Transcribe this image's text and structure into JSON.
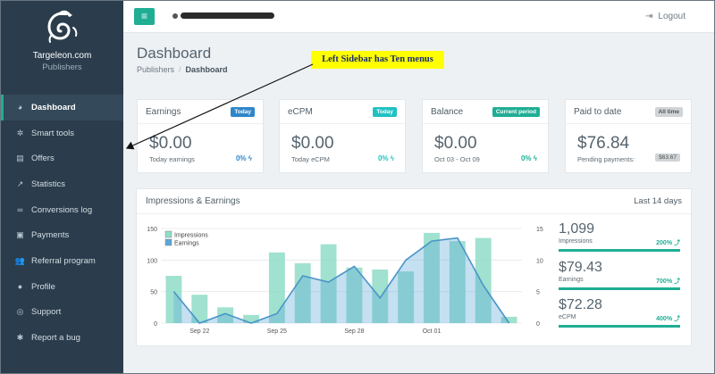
{
  "sidebar": {
    "brand_name": "Targeleon.com",
    "brand_sub": "Publishers",
    "items": [
      {
        "label": "Dashboard",
        "icon": "dashboard-icon",
        "active": true
      },
      {
        "label": "Smart tools",
        "icon": "gears-icon"
      },
      {
        "label": "Offers",
        "icon": "list-icon"
      },
      {
        "label": "Statistics",
        "icon": "chart-icon"
      },
      {
        "label": "Conversions log",
        "icon": "link-icon"
      },
      {
        "label": "Payments",
        "icon": "money-icon"
      },
      {
        "label": "Referral program",
        "icon": "users-icon"
      },
      {
        "label": "Profile",
        "icon": "user-icon"
      },
      {
        "label": "Support",
        "icon": "lifebuoy-icon"
      },
      {
        "label": "Report a bug",
        "icon": "bug-icon"
      }
    ]
  },
  "topbar": {
    "logout_label": "Logout"
  },
  "header": {
    "title": "Dashboard",
    "crumb_parent": "Publishers",
    "crumb_current": "Dashboard"
  },
  "annotation": {
    "text": "Left Sidebar has Ten menus"
  },
  "cards": [
    {
      "title": "Earnings",
      "badge": "Today",
      "value": "$0.00",
      "sub": "Today earnings",
      "pct": "0%"
    },
    {
      "title": "eCPM",
      "badge": "Today",
      "value": "$0.00",
      "sub": "Today eCPM",
      "pct": "0%"
    },
    {
      "title": "Balance",
      "badge": "Current period",
      "value": "$0.00",
      "sub": "Oct 03 - Oct 09",
      "pct": "0%"
    },
    {
      "title": "Paid to date",
      "badge": "All time",
      "value": "$76.84",
      "sub": "Pending payments:",
      "pill": "$63.67"
    }
  ],
  "panel": {
    "title": "Impressions & Earnings",
    "range": "Last 14 days"
  },
  "metrics": [
    {
      "value": "1,099",
      "label": "Impressions",
      "pct": "200%"
    },
    {
      "value": "$79.43",
      "label": "Earnings",
      "pct": "700%"
    },
    {
      "value": "$72.28",
      "label": "eCPM",
      "pct": "400%"
    }
  ],
  "chart_data": {
    "type": "bar",
    "categories": [
      "Sep 21",
      "Sep 22",
      "Sep 23",
      "Sep 24",
      "Sep 25",
      "Sep 26",
      "Sep 27",
      "Sep 28",
      "Sep 29",
      "Sep 30",
      "Oct 01",
      "Oct 02",
      "Oct 03",
      "Oct 04"
    ],
    "tick_labels": [
      "Sep 22",
      "Sep 25",
      "Sep 28",
      "Oct 01"
    ],
    "series": [
      {
        "name": "Impressions",
        "axis": "left",
        "values": [
          75,
          45,
          25,
          13,
          112,
          95,
          125,
          88,
          85,
          82,
          143,
          130,
          135,
          10
        ]
      },
      {
        "name": "Earnings",
        "axis": "right",
        "values": [
          5,
          0,
          1.5,
          0,
          1.5,
          7.5,
          6.5,
          9,
          4,
          10,
          13,
          13.5,
          6,
          0
        ]
      }
    ],
    "ylim_left": [
      0,
      150
    ],
    "yticks_left": [
      0,
      50,
      100,
      150
    ],
    "ylim_right": [
      0,
      15
    ],
    "yticks_right": [
      0,
      5,
      10,
      15
    ],
    "legend": "top-left",
    "colors": {
      "impressions": "#8fdcc7",
      "earnings": "#5aa6d6"
    }
  }
}
